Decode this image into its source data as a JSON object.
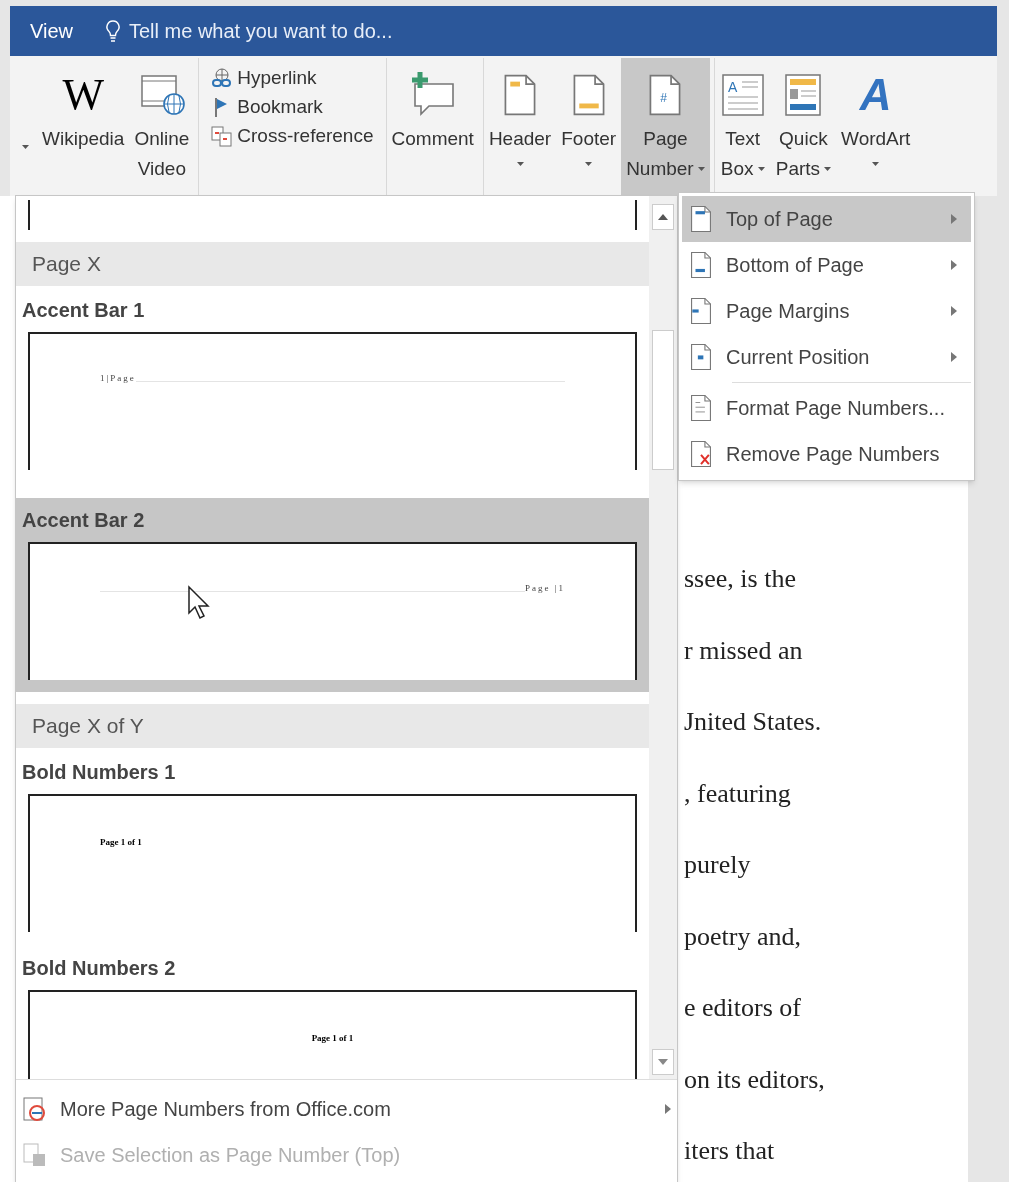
{
  "title_bar": {
    "tab": "View",
    "search": {
      "placeholder": "Tell me what you want to do..."
    }
  },
  "ribbon": [
    {
      "kind": "large",
      "glyph": "W",
      "lines": [
        "Wikipedia"
      ],
      "dropdown": false,
      "selected": false,
      "lead_caret": true
    },
    {
      "kind": "large",
      "lines": [
        "Online",
        "Video"
      ],
      "dropdown": false,
      "selected": false
    },
    {
      "kind": "stack",
      "items": [
        {
          "label": "Hyperlink"
        },
        {
          "label": "Bookmark"
        },
        {
          "label": "Cross-reference"
        }
      ]
    },
    {
      "kind": "large",
      "lines": [
        "Comment"
      ],
      "dropdown": false,
      "selected": false
    },
    {
      "kind": "large",
      "lines": [
        "Header"
      ],
      "dropdown": true,
      "selected": false
    },
    {
      "kind": "large",
      "lines": [
        "Footer"
      ],
      "dropdown": true,
      "selected": false
    },
    {
      "kind": "large",
      "glyph": "#",
      "lines": [
        "Page",
        "Number"
      ],
      "dropdown": true,
      "selected": true
    },
    {
      "kind": "large",
      "glyph": "A",
      "lines": [
        "Text",
        "Box"
      ],
      "dropdown": true,
      "selected": false
    },
    {
      "kind": "large",
      "lines": [
        "Quick",
        "Parts"
      ],
      "dropdown": true,
      "selected": false
    },
    {
      "kind": "large",
      "glyph": "A",
      "lines": [
        "WordArt"
      ],
      "dropdown": true,
      "selected": false
    }
  ],
  "document_lines": [
    "ssee, is the",
    "r missed an",
    "Jnited States.",
    ", featuring",
    "purely",
    "poetry and,",
    "e editors of",
    "on its editors,",
    "iters that"
  ],
  "gallery": {
    "sections": [
      {
        "heading": "Page X",
        "items": [
          {
            "name": "Accent Bar 1",
            "preview": "1|Page",
            "kind": "left",
            "selected": false
          },
          {
            "name": "Accent Bar 2",
            "preview": "Page |1",
            "kind": "right",
            "selected": true
          }
        ]
      },
      {
        "heading": "Page X of Y",
        "items": [
          {
            "name": "Bold Numbers 1",
            "preview": "Page 1 of 1",
            "kind": "left",
            "selected": false
          },
          {
            "name": "Bold Numbers 2",
            "preview": "Page 1 of 1",
            "kind": "center",
            "selected": false
          }
        ]
      }
    ],
    "footer": [
      {
        "label": "More Page Numbers from Office.com",
        "submenu": true,
        "disabled": false
      },
      {
        "label": "Save Selection as Page Number (Top)",
        "submenu": false,
        "disabled": true
      }
    ]
  },
  "menu": [
    {
      "label": "Top of Page",
      "submenu": true,
      "selected": true
    },
    {
      "label": "Bottom of Page",
      "submenu": true,
      "selected": false
    },
    {
      "label": "Page Margins",
      "submenu": true,
      "selected": false
    },
    {
      "label": "Current Position",
      "submenu": true,
      "selected": false
    },
    {
      "label": "Format Page Numbers...",
      "submenu": false,
      "selected": false,
      "separator_before": true
    },
    {
      "label": "Remove Page Numbers",
      "submenu": false,
      "selected": false
    }
  ]
}
